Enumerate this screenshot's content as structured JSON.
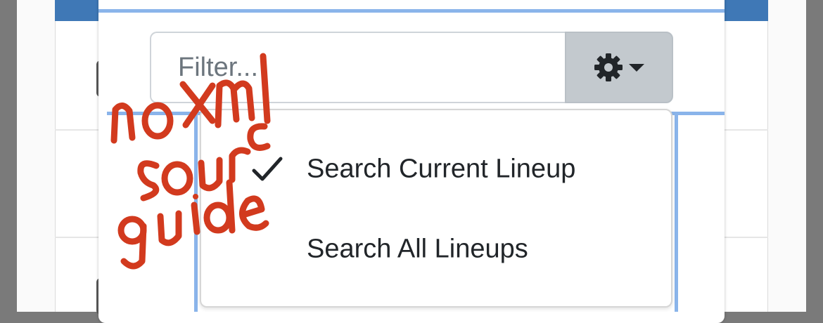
{
  "filter": {
    "placeholder": "Filter..."
  },
  "settings": {
    "icon": "gear-icon",
    "caret_icon": "caret-down-icon"
  },
  "search_menu": {
    "items": [
      {
        "label": "Search Current Lineup",
        "checked": true
      },
      {
        "label": "Search All Lineups",
        "checked": false
      }
    ]
  },
  "annotation": {
    "lines": [
      "no xml",
      "source",
      "guide"
    ],
    "color": "#d23a1e"
  },
  "colors": {
    "header": "#3f78b6",
    "focus": "#8ab4ea",
    "button": "#c3c9ce",
    "text": "#212529",
    "placeholder": "#6c757d"
  }
}
